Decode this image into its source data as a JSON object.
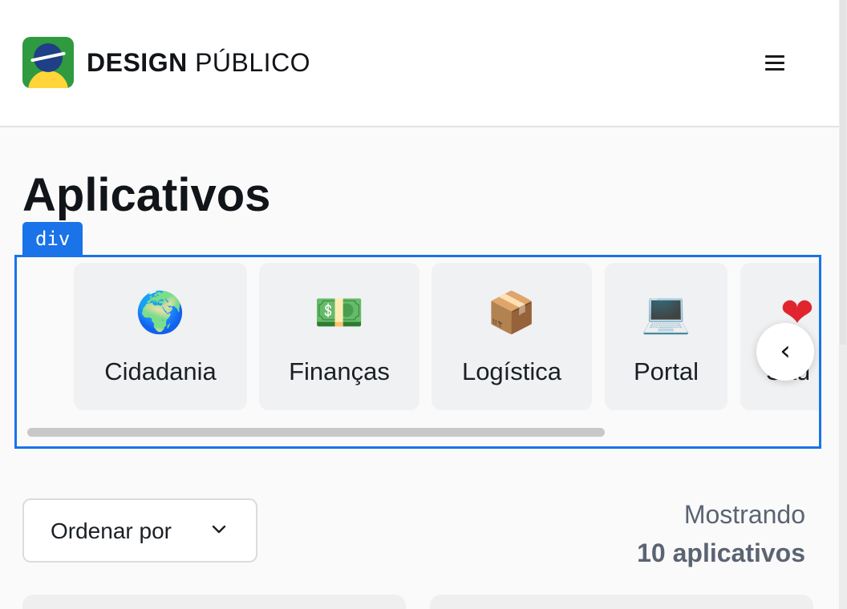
{
  "header": {
    "brand_bold": "DESIGN",
    "brand_regular": "PÚBLICO",
    "menu_icon": "hamburger-menu-icon"
  },
  "main": {
    "title": "Aplicativos",
    "inspector_tag": "div",
    "categories": [
      {
        "label": "Cidadania",
        "emoji": "🌍",
        "icon": "globe-icon"
      },
      {
        "label": "Finanças",
        "emoji": "💵",
        "icon": "money-icon"
      },
      {
        "label": "Logística",
        "emoji": "📦",
        "icon": "hand-truck-boxes-icon"
      },
      {
        "label": "Portal",
        "emoji": "💻",
        "icon": "laptop-icon"
      },
      {
        "label": "Saú",
        "emoji": "❤",
        "icon": "heart-icon"
      }
    ],
    "carousel_prev_glyph": "‹",
    "sort": {
      "label": "Ordenar por"
    },
    "count": {
      "line1": "Mostrando",
      "line2": "10 aplicativos"
    }
  },
  "colors": {
    "accent": "#1a73e8",
    "logo_green": "#2f9a3f",
    "logo_yellow": "#ffd53a",
    "logo_blue": "#1f3f86"
  }
}
